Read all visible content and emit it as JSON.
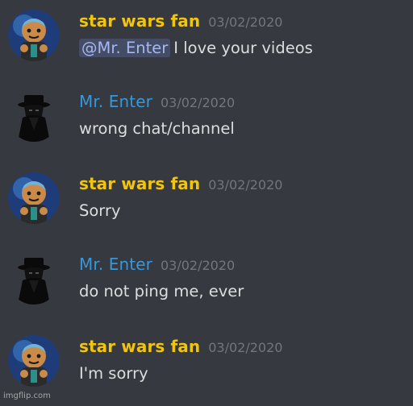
{
  "messages": [
    {
      "author": "star wars fan",
      "timestamp": "03/02/2020",
      "mention": "@Mr. Enter",
      "text": "I love your videos",
      "avatar": "gingerbread-avatar",
      "name_color": "#f1c40f"
    },
    {
      "author": "Mr. Enter",
      "timestamp": "03/02/2020",
      "mention": "",
      "text": "wrong chat/channel",
      "avatar": "shadow-figure-avatar",
      "name_color": "#3498db"
    },
    {
      "author": "star wars fan",
      "timestamp": "03/02/2020",
      "mention": "",
      "text": "Sorry",
      "avatar": "gingerbread-avatar",
      "name_color": "#f1c40f"
    },
    {
      "author": "Mr. Enter",
      "timestamp": "03/02/2020",
      "mention": "",
      "text": "do not ping me, ever",
      "avatar": "shadow-figure-avatar",
      "name_color": "#3498db"
    },
    {
      "author": "star wars fan",
      "timestamp": "03/02/2020",
      "mention": "",
      "text": "I'm sorry",
      "avatar": "gingerbread-avatar",
      "name_color": "#f1c40f"
    }
  ],
  "watermark": "imgflip.com",
  "colors": {
    "background": "#36393f",
    "text": "#dcddde",
    "timestamp": "#72767d",
    "mention_bg": "#3d4270",
    "mention_text": "#a6b8f0"
  }
}
